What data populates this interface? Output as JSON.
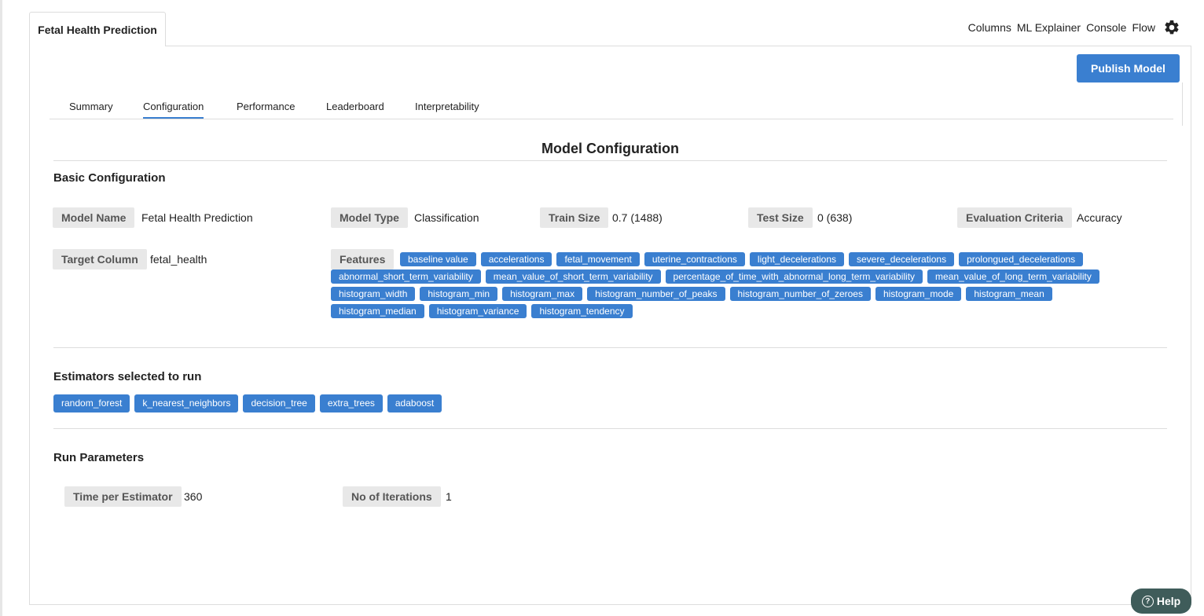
{
  "header": {
    "doc_tab": "Fetal Health Prediction",
    "menu": [
      "Columns",
      "ML Explainer",
      "Console",
      "Flow"
    ],
    "settings_icon": "gear-icon"
  },
  "publish_button": "Publish Model",
  "tabs": [
    {
      "label": "Summary",
      "active": false
    },
    {
      "label": "Configuration",
      "active": true
    },
    {
      "label": "Performance",
      "active": false
    },
    {
      "label": "Leaderboard",
      "active": false
    },
    {
      "label": "Interpretability",
      "active": false
    }
  ],
  "page_title": "Model Configuration",
  "basic": {
    "title": "Basic Configuration",
    "model_name": {
      "label": "Model Name",
      "value": "Fetal Health Prediction"
    },
    "model_type": {
      "label": "Model Type",
      "value": "Classification"
    },
    "train_size": {
      "label": "Train Size",
      "value": "0.7 (1488)"
    },
    "test_size": {
      "label": "Test Size",
      "value": "0 (638)"
    },
    "eval": {
      "label": "Evaluation Criteria",
      "value": "Accuracy"
    },
    "target": {
      "label": "Target Column",
      "value": "fetal_health"
    },
    "features_label": "Features",
    "features": [
      "baseline value",
      "accelerations",
      "fetal_movement",
      "uterine_contractions",
      "light_decelerations",
      "severe_decelerations",
      "prolongued_decelerations",
      "abnormal_short_term_variability",
      "mean_value_of_short_term_variability",
      "percentage_of_time_with_abnormal_long_term_variability",
      "mean_value_of_long_term_variability",
      "histogram_width",
      "histogram_min",
      "histogram_max",
      "histogram_number_of_peaks",
      "histogram_number_of_zeroes",
      "histogram_mode",
      "histogram_mean",
      "histogram_median",
      "histogram_variance",
      "histogram_tendency"
    ]
  },
  "estimators": {
    "title": "Estimators selected to run",
    "items": [
      "random_forest",
      "k_nearest_neighbors",
      "decision_tree",
      "extra_trees",
      "adaboost"
    ]
  },
  "run_params": {
    "title": "Run Parameters",
    "time_per_estimator": {
      "label": "Time per Estimator",
      "value": "360"
    },
    "iterations": {
      "label": "No of Iterations",
      "value": "1"
    }
  },
  "help": {
    "label": "Help",
    "icon": "question-circle-icon"
  },
  "colors": {
    "accent": "#3a7fd0",
    "label_bg": "#e8e8e8",
    "help_bg": "#3f5c5a"
  }
}
